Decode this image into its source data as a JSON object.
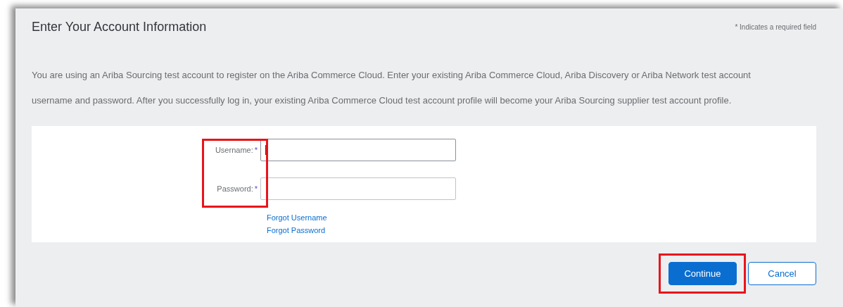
{
  "panel": {
    "title": "Enter Your Account Information",
    "required_note": "* Indicates a required field",
    "intro": "You are using an Ariba Sourcing test account to register on the Ariba Commerce Cloud. Enter your existing Ariba Commerce Cloud, Ariba Discovery or Ariba Network test account username and password. After you successfully log in, your existing Ariba Commerce Cloud test account profile will become your Ariba Sourcing supplier test account profile."
  },
  "form": {
    "labels_highlighted": true,
    "fields": [
      {
        "label": "Username:",
        "required_mark": "*",
        "focused": true
      },
      {
        "label": "Password:",
        "required_mark": "*",
        "focused": false
      }
    ],
    "links": [
      "Forgot Username",
      "Forgot Password"
    ]
  },
  "buttons": [
    {
      "label": "Continue",
      "kind": "primary",
      "highlighted": true
    },
    {
      "label": "Cancel",
      "kind": "secondary",
      "highlighted": false
    }
  ]
}
